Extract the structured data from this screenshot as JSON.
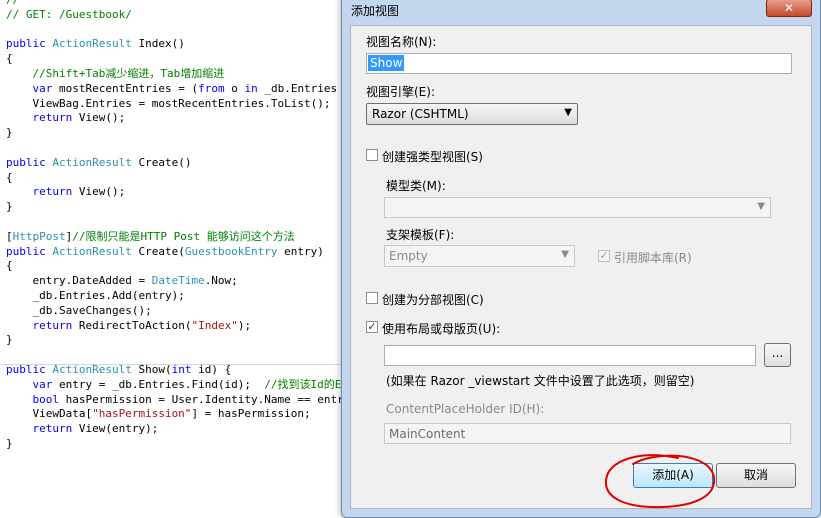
{
  "editor": {
    "lines": [
      [
        {
          "t": "//",
          "c": "cm"
        }
      ],
      [
        {
          "t": "// GET: /Guestbook/",
          "c": "cm"
        }
      ],
      [],
      [
        {
          "t": "public ",
          "c": "kw"
        },
        {
          "t": "ActionResult",
          "c": "ty"
        },
        {
          "t": " Index()"
        }
      ],
      [
        {
          "t": "{"
        }
      ],
      [
        {
          "t": "    //Shift+Tab减少缩进，Tab增加缩进",
          "c": "cm"
        }
      ],
      [
        {
          "t": "    "
        },
        {
          "t": "var",
          "c": "kw"
        },
        {
          "t": " mostRecentEntries = ("
        },
        {
          "t": "from",
          "c": "kw"
        },
        {
          "t": " o "
        },
        {
          "t": "in",
          "c": "kw"
        },
        {
          "t": " _db.Entries o"
        }
      ],
      [
        {
          "t": "    ViewBag.Entries = mostRecentEntries.ToList();"
        }
      ],
      [
        {
          "t": "    "
        },
        {
          "t": "return",
          "c": "kw"
        },
        {
          "t": " View();"
        }
      ],
      [
        {
          "t": "}"
        }
      ],
      [],
      [
        {
          "t": "public ",
          "c": "kw"
        },
        {
          "t": "ActionResult",
          "c": "ty"
        },
        {
          "t": " Create()"
        }
      ],
      [
        {
          "t": "{"
        }
      ],
      [
        {
          "t": "    "
        },
        {
          "t": "return",
          "c": "kw"
        },
        {
          "t": " View();"
        }
      ],
      [
        {
          "t": "}"
        }
      ],
      [],
      [
        {
          "t": "["
        },
        {
          "t": "HttpPost",
          "c": "ty"
        },
        {
          "t": "]"
        },
        {
          "t": "//限制只能是HTTP Post 能够访问这个方法",
          "c": "cm"
        }
      ],
      [
        {
          "t": "public ",
          "c": "kw"
        },
        {
          "t": "ActionResult",
          "c": "ty"
        },
        {
          "t": " Create("
        },
        {
          "t": "GuestbookEntry",
          "c": "ty"
        },
        {
          "t": " entry)"
        }
      ],
      [
        {
          "t": "{"
        }
      ],
      [
        {
          "t": "    entry.DateAdded = "
        },
        {
          "t": "DateTime",
          "c": "ty"
        },
        {
          "t": ".Now;"
        }
      ],
      [
        {
          "t": "    _db.Entries.Add(entry);"
        }
      ],
      [
        {
          "t": "    _db.SaveChanges();"
        }
      ],
      [
        {
          "t": "    "
        },
        {
          "t": "return",
          "c": "kw"
        },
        {
          "t": " RedirectToAction("
        },
        {
          "t": "\"Index\"",
          "c": "st"
        },
        {
          "t": ");"
        }
      ],
      [
        {
          "t": "}"
        }
      ],
      [],
      [
        {
          "t": "public ",
          "c": "kw"
        },
        {
          "t": "ActionResult",
          "c": "ty"
        },
        {
          "t": " Show("
        },
        {
          "t": "int",
          "c": "kw"
        },
        {
          "t": " id) {"
        }
      ],
      [
        {
          "t": "    "
        },
        {
          "t": "var",
          "c": "kw"
        },
        {
          "t": " entry = _db.Entries.Find(id);  "
        },
        {
          "t": "//找到该Id的E",
          "c": "cm"
        }
      ],
      [
        {
          "t": "    "
        },
        {
          "t": "bool",
          "c": "kw"
        },
        {
          "t": " hasPermission = User.Identity.Name == entry"
        }
      ],
      [
        {
          "t": "    ViewData["
        },
        {
          "t": "\"hasPermission\"",
          "c": "st"
        },
        {
          "t": "] = hasPermission;"
        }
      ],
      [
        {
          "t": "    "
        },
        {
          "t": "return",
          "c": "kw"
        },
        {
          "t": " View(entry);"
        }
      ],
      [
        {
          "t": "}"
        }
      ]
    ]
  },
  "dialog": {
    "title": "添加视图",
    "close_glyph": "✕",
    "view_name_label": "视图名称(N):",
    "view_name_value": "Show",
    "view_engine_label": "视图引擎(E):",
    "view_engine_value": "Razor (CSHTML)",
    "strongly_typed_label": "创建强类型视图(S)",
    "strongly_typed_checked": false,
    "model_class_label": "模型类(M):",
    "model_class_value": "",
    "scaffold_template_label": "支架模板(F):",
    "scaffold_template_value": "Empty",
    "reference_scripts_label": "引用脚本库(R)",
    "reference_scripts_checked": true,
    "partial_view_label": "创建为分部视图(C)",
    "partial_view_checked": false,
    "use_layout_label": "使用布局或母版页(U):",
    "use_layout_checked": true,
    "layout_path_value": "",
    "browse_label": "...",
    "layout_hint": "(如果在 Razor _viewstart 文件中设置了此选项，则留空)",
    "placeholder_id_label": "ContentPlaceHolder ID(H):",
    "placeholder_id_value": "MainContent",
    "add_label": "添加(A)",
    "cancel_label": "取消",
    "check_glyph": "✓",
    "dropdown_glyph": "▼"
  },
  "colors": {
    "keyword": "#0000ff",
    "type": "#2b91af",
    "comment": "#008000",
    "string": "#a31515",
    "annotation_circle": "#e00000",
    "selection": "#3399ff"
  }
}
